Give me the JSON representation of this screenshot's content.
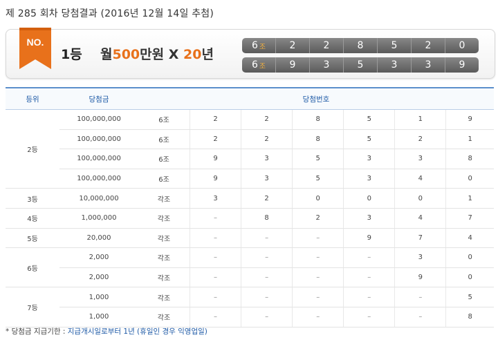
{
  "header": {
    "title_main": "제 285 회차 당첨결과",
    "title_date": "(2016년 12월 14일 추첨)"
  },
  "banner": {
    "badge": "NO.",
    "rank": "1등",
    "prize_prefix": "월",
    "prize_amount": "500",
    "prize_unit": "만원",
    "prize_x": "X",
    "prize_years": "20",
    "prize_years_unit": "년",
    "colors": {
      "accent": "#e8711b",
      "badge": "#e8711b",
      "number_bg": "#6b6b6b",
      "group": "#f7b23b"
    },
    "rows": [
      {
        "group": "6",
        "group_unit": "조",
        "digits": [
          "2",
          "2",
          "8",
          "5",
          "2",
          "0"
        ]
      },
      {
        "group": "6",
        "group_unit": "조",
        "digits": [
          "9",
          "3",
          "5",
          "3",
          "3",
          "9"
        ]
      }
    ]
  },
  "table": {
    "headers": {
      "rank": "등위",
      "amount": "당첨금",
      "numbers": "당첨번호"
    },
    "groups": [
      {
        "rank": "2등",
        "rows": [
          {
            "amount": "100,000,000",
            "group": "6조",
            "digits": [
              "2",
              "2",
              "8",
              "5",
              "1",
              "9"
            ]
          },
          {
            "amount": "100,000,000",
            "group": "6조",
            "digits": [
              "2",
              "2",
              "8",
              "5",
              "2",
              "1"
            ]
          },
          {
            "amount": "100,000,000",
            "group": "6조",
            "digits": [
              "9",
              "3",
              "5",
              "3",
              "3",
              "8"
            ]
          },
          {
            "amount": "100,000,000",
            "group": "6조",
            "digits": [
              "9",
              "3",
              "5",
              "3",
              "4",
              "0"
            ]
          }
        ]
      },
      {
        "rank": "3등",
        "rows": [
          {
            "amount": "10,000,000",
            "group": "각조",
            "digits": [
              "3",
              "2",
              "0",
              "0",
              "0",
              "1"
            ]
          }
        ]
      },
      {
        "rank": "4등",
        "rows": [
          {
            "amount": "1,000,000",
            "group": "각조",
            "digits": [
              "–",
              "8",
              "2",
              "3",
              "4",
              "7"
            ]
          }
        ]
      },
      {
        "rank": "5등",
        "rows": [
          {
            "amount": "20,000",
            "group": "각조",
            "digits": [
              "–",
              "–",
              "–",
              "9",
              "7",
              "4"
            ]
          }
        ]
      },
      {
        "rank": "6등",
        "rows": [
          {
            "amount": "2,000",
            "group": "각조",
            "digits": [
              "–",
              "–",
              "–",
              "–",
              "3",
              "0"
            ]
          },
          {
            "amount": "2,000",
            "group": "각조",
            "digits": [
              "–",
              "–",
              "–",
              "–",
              "9",
              "0"
            ]
          }
        ]
      },
      {
        "rank": "7등",
        "rows": [
          {
            "amount": "1,000",
            "group": "각조",
            "digits": [
              "–",
              "–",
              "–",
              "–",
              "–",
              "5"
            ]
          },
          {
            "amount": "1,000",
            "group": "각조",
            "digits": [
              "–",
              "–",
              "–",
              "–",
              "–",
              "8"
            ]
          }
        ]
      }
    ]
  },
  "footnote": {
    "label": "* 당첨금 지급기한 :",
    "text": "지급개시일로부터 1년 (휴일인 경우 익영업일)"
  }
}
